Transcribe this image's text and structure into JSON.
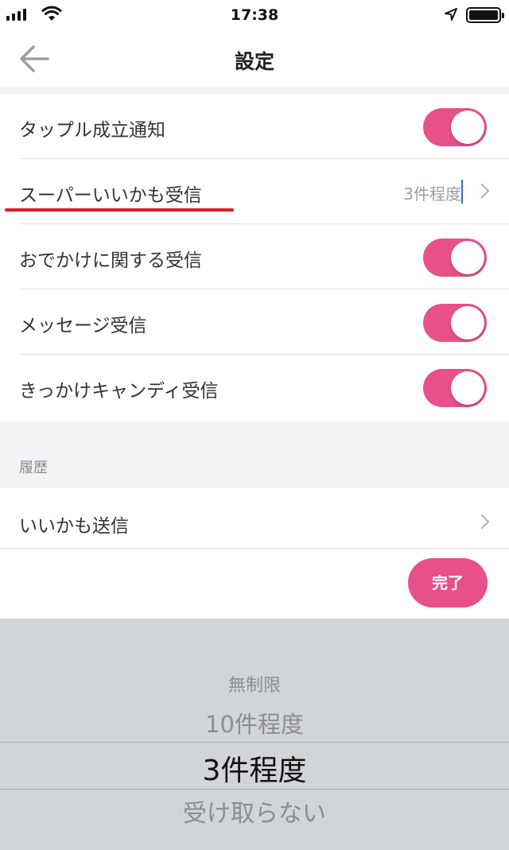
{
  "status_bar": {
    "time": "17:38"
  },
  "nav": {
    "title": "設定"
  },
  "notifications": [
    {
      "label": "タップル成立通知",
      "type": "toggle",
      "on": true
    },
    {
      "label": "スーパーいいかも受信",
      "type": "select",
      "value": "3件程度"
    },
    {
      "label": "おでかけに関する受信",
      "type": "toggle",
      "on": true
    },
    {
      "label": "メッセージ受信",
      "type": "toggle",
      "on": true
    },
    {
      "label": "きっかけキャンディ受信",
      "type": "toggle",
      "on": true
    }
  ],
  "history": {
    "section_title": "履歴",
    "item_label": "いいかも送信"
  },
  "toolbar": {
    "done_label": "完了"
  },
  "picker": {
    "options": [
      "無制限",
      "10件程度",
      "3件程度",
      "受け取らない"
    ],
    "selected": "3件程度"
  },
  "colors": {
    "accent": "#e8508a",
    "annotation": "#e11c24",
    "cursor": "#2c6ed8",
    "picker_bg": "#d1d4d8",
    "section_bg": "#f2f3f5"
  }
}
